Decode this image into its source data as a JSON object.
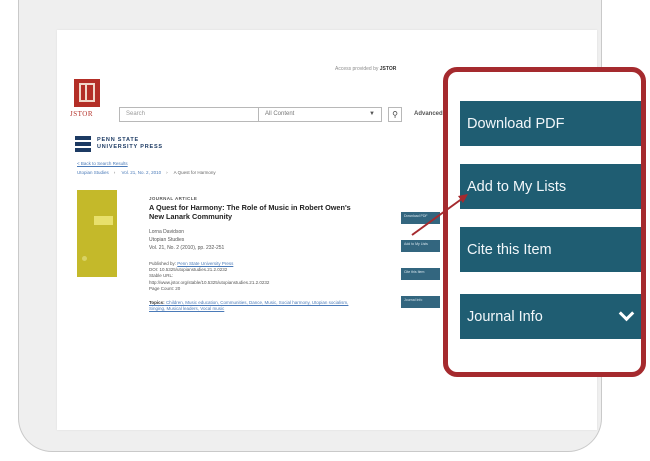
{
  "header": {
    "access_text": "Access provided by ",
    "access_org": "JSTOR",
    "logo_text": "JSTOR",
    "search_placeholder": "Search",
    "content_select_value": "All Content",
    "advanced_label": "Advanced"
  },
  "publisher": {
    "line1": "PENN STATE",
    "line2": "UNIVERSITY PRESS"
  },
  "breadcrumb": {
    "back_link": "< Back to Search Results",
    "items": [
      "Utopian Studies",
      "Vol. 21, No. 2, 2010",
      "A Quest for Harmony"
    ]
  },
  "article": {
    "type": "JOURNAL ARTICLE",
    "title": "A Quest for Harmony: The Role of Music in Robert Owen's New Lanark Community",
    "author": "Lorna Davidson",
    "journal": "Utopian Studies",
    "citation": "Vol. 21, No. 2 (2010), pp. 232-251",
    "published_by_label": "Published by:",
    "publisher_link": "Penn State University Press",
    "doi": "DOI: 10.5325/utopianstudies.21.2.0232",
    "stable_url_label": "Stable URL:",
    "stable_url": "http://www.jstor.org/stable/10.5325/utopianstudies.21.2.0232",
    "page_count": "Page Count: 20",
    "topics_label": "Topics:",
    "topics_text": "Children, Music education, Communities, Dance, Music, Social harmony, Utopian socialism, Singing, Musical leaders, Vocal music"
  },
  "side_buttons": {
    "download": "Download PDF",
    "add_to_lists": "Add to My Lists",
    "cite": "Cite this Item",
    "journal_info": "Journal Info"
  },
  "callout": {
    "download_label": "Download PDF",
    "add_label": "Add to My Lists",
    "cite_label": "Cite this Item",
    "journal_label": "Journal Info",
    "panel_color": "#1f5d72",
    "border_color": "#a52a2e"
  }
}
